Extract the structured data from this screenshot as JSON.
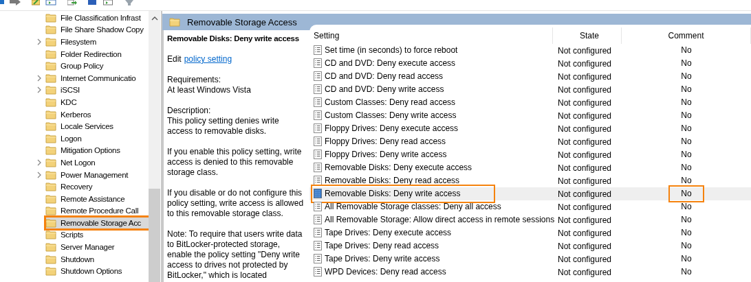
{
  "tree": {
    "items": [
      {
        "label": "File Classification Infrast",
        "expandable": false,
        "selected": false,
        "outlined": false
      },
      {
        "label": "File Share Shadow Copy",
        "expandable": false,
        "selected": false,
        "outlined": false
      },
      {
        "label": "Filesystem",
        "expandable": true,
        "selected": false,
        "outlined": false
      },
      {
        "label": "Folder Redirection",
        "expandable": false,
        "selected": false,
        "outlined": false
      },
      {
        "label": "Group Policy",
        "expandable": false,
        "selected": false,
        "outlined": false
      },
      {
        "label": "Internet Communicatio",
        "expandable": true,
        "selected": false,
        "outlined": false
      },
      {
        "label": "iSCSI",
        "expandable": true,
        "selected": false,
        "outlined": false
      },
      {
        "label": "KDC",
        "expandable": false,
        "selected": false,
        "outlined": false
      },
      {
        "label": "Kerberos",
        "expandable": false,
        "selected": false,
        "outlined": false
      },
      {
        "label": "Locale Services",
        "expandable": false,
        "selected": false,
        "outlined": false
      },
      {
        "label": "Logon",
        "expandable": false,
        "selected": false,
        "outlined": false
      },
      {
        "label": "Mitigation Options",
        "expandable": false,
        "selected": false,
        "outlined": false
      },
      {
        "label": "Net Logon",
        "expandable": true,
        "selected": false,
        "outlined": false
      },
      {
        "label": "Power Management",
        "expandable": true,
        "selected": false,
        "outlined": false
      },
      {
        "label": "Recovery",
        "expandable": false,
        "selected": false,
        "outlined": false
      },
      {
        "label": "Remote Assistance",
        "expandable": false,
        "selected": false,
        "outlined": false
      },
      {
        "label": "Remote Procedure Call",
        "expandable": false,
        "selected": false,
        "outlined": false
      },
      {
        "label": "Removable Storage Acc",
        "expandable": false,
        "selected": true,
        "outlined": true
      },
      {
        "label": "Scripts",
        "expandable": false,
        "selected": false,
        "outlined": false
      },
      {
        "label": "Server Manager",
        "expandable": false,
        "selected": false,
        "outlined": false
      },
      {
        "label": "Shutdown",
        "expandable": false,
        "selected": false,
        "outlined": false
      },
      {
        "label": "Shutdown Options",
        "expandable": false,
        "selected": false,
        "outlined": false
      }
    ]
  },
  "header": {
    "title": "Removable Storage Access"
  },
  "description": {
    "title": "Removable Disks: Deny write access",
    "edit_prefix": "Edit",
    "edit_link": "policy setting",
    "paragraphs": [
      "Requirements:\nAt least Windows Vista",
      "Description:\nThis policy setting denies write access to removable disks.",
      "If you enable this policy setting, write access is denied to this removable storage class.",
      "If you disable or do not configure this policy setting, write access is allowed to this removable storage class.",
      "Note: To require that users write data to BitLocker-protected storage, enable the policy setting \"Deny write access to drives not protected by BitLocker,\" which is located"
    ]
  },
  "table": {
    "columns": [
      "Setting",
      "State",
      "Comment"
    ],
    "rows": [
      {
        "setting": "Set time (in seconds) to force reboot",
        "state": "Not configured",
        "comment": "No",
        "selected": false,
        "outlined": false
      },
      {
        "setting": "CD and DVD: Deny execute access",
        "state": "Not configured",
        "comment": "No",
        "selected": false,
        "outlined": false
      },
      {
        "setting": "CD and DVD: Deny read access",
        "state": "Not configured",
        "comment": "No",
        "selected": false,
        "outlined": false
      },
      {
        "setting": "CD and DVD: Deny write access",
        "state": "Not configured",
        "comment": "No",
        "selected": false,
        "outlined": false
      },
      {
        "setting": "Custom Classes: Deny read access",
        "state": "Not configured",
        "comment": "No",
        "selected": false,
        "outlined": false
      },
      {
        "setting": "Custom Classes: Deny write access",
        "state": "Not configured",
        "comment": "No",
        "selected": false,
        "outlined": false
      },
      {
        "setting": "Floppy Drives: Deny execute access",
        "state": "Not configured",
        "comment": "No",
        "selected": false,
        "outlined": false
      },
      {
        "setting": "Floppy Drives: Deny read access",
        "state": "Not configured",
        "comment": "No",
        "selected": false,
        "outlined": false
      },
      {
        "setting": "Floppy Drives: Deny write access",
        "state": "Not configured",
        "comment": "No",
        "selected": false,
        "outlined": false
      },
      {
        "setting": "Removable Disks: Deny execute access",
        "state": "Not configured",
        "comment": "No",
        "selected": false,
        "outlined": false
      },
      {
        "setting": "Removable Disks: Deny read access",
        "state": "Not configured",
        "comment": "No",
        "selected": false,
        "outlined": false
      },
      {
        "setting": "Removable Disks: Deny write access",
        "state": "Not configured",
        "comment": "No",
        "selected": true,
        "outlined": true
      },
      {
        "setting": "All Removable Storage classes: Deny all access",
        "state": "Not configured",
        "comment": "No",
        "selected": false,
        "outlined": false
      },
      {
        "setting": "All Removable Storage: Allow direct access in remote sessions",
        "state": "Not configured",
        "comment": "No",
        "selected": false,
        "outlined": false
      },
      {
        "setting": "Tape Drives: Deny execute access",
        "state": "Not configured",
        "comment": "No",
        "selected": false,
        "outlined": false
      },
      {
        "setting": "Tape Drives: Deny read access",
        "state": "Not configured",
        "comment": "No",
        "selected": false,
        "outlined": false
      },
      {
        "setting": "Tape Drives: Deny write access",
        "state": "Not configured",
        "comment": "No",
        "selected": false,
        "outlined": false
      },
      {
        "setting": "WPD Devices: Deny read access",
        "state": "Not configured",
        "comment": "No",
        "selected": false,
        "outlined": false
      }
    ]
  }
}
